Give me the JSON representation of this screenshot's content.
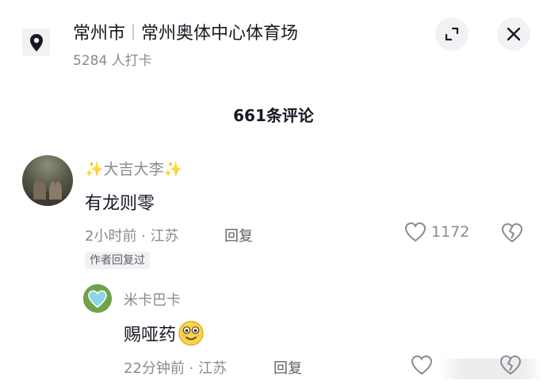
{
  "header": {
    "city": "常州市",
    "venue": "常州奥体中心体育场",
    "checkin": "5284 人打卡",
    "location_icon": "map-pin-icon",
    "expand_icon": "expand-icon",
    "close_icon": "close-icon"
  },
  "comments_header": {
    "count_label": "661条评论"
  },
  "comment": {
    "author": "✨大吉大李✨",
    "text": "有龙则零",
    "time_location": "2小时前 · 江苏",
    "reply_label": "回复",
    "like_count": "1172",
    "badge": "作者回复过",
    "like_icon": "heart-outline-icon",
    "dislike_icon": "broken-heart-icon"
  },
  "reply": {
    "author": "米卡巴卡",
    "text": "赐哑药",
    "emoji": "smiling-face-emoji",
    "time_location": "22分钟前 · 江苏",
    "reply_label": "回复",
    "like_icon": "heart-outline-icon",
    "dislike_icon": "broken-heart-icon"
  },
  "colors": {
    "primary_text": "#161823",
    "secondary_text": "#8a8b91",
    "button_bg": "#f2f2f4"
  }
}
